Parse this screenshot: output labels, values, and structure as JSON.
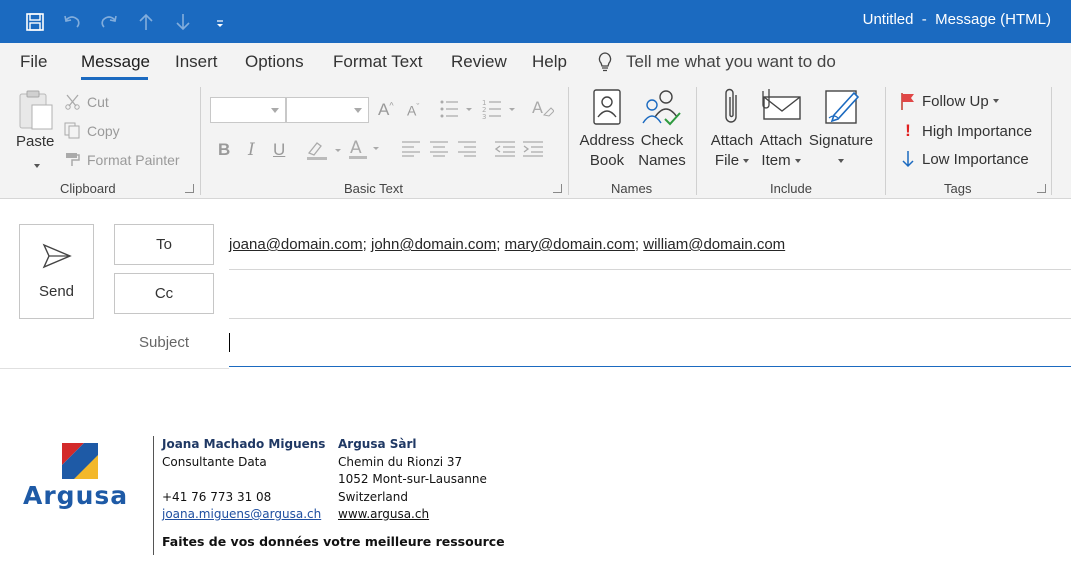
{
  "window": {
    "title": "Untitled  -  Message (HTML)"
  },
  "tabs": [
    {
      "label": "File"
    },
    {
      "label": "Message"
    },
    {
      "label": "Insert"
    },
    {
      "label": "Options"
    },
    {
      "label": "Format Text"
    },
    {
      "label": "Review"
    },
    {
      "label": "Help"
    }
  ],
  "tell_me": {
    "label": "Tell me what you want to do"
  },
  "ribbon": {
    "clipboard": {
      "paste": "Paste",
      "cut": "Cut",
      "copy": "Copy",
      "format_painter": "Format Painter",
      "group": "Clipboard"
    },
    "basic_text": {
      "bold": "B",
      "italic": "I",
      "underline": "U",
      "group": "Basic Text"
    },
    "names": {
      "address_book_1": "Address",
      "address_book_2": "Book",
      "check_names_1": "Check",
      "check_names_2": "Names",
      "group": "Names"
    },
    "include": {
      "attach_file_1": "Attach",
      "attach_file_2": "File",
      "attach_item_1": "Attach",
      "attach_item_2": "Item",
      "signature": "Signature",
      "group": "Include"
    },
    "tags": {
      "follow_up": "Follow Up",
      "high": "High Importance",
      "low": "Low Importance",
      "group": "Tags"
    }
  },
  "compose": {
    "send": "Send",
    "to": "To",
    "cc": "Cc",
    "subject": "Subject",
    "recipients": [
      "joana@domain.com",
      "john@domain.com",
      "mary@domain.com",
      "william@domain.com"
    ]
  },
  "signature": {
    "logo": "Argusa",
    "name": "Joana Machado Miguens",
    "role": "Consultante Data",
    "phone": "+41 76 773 31 08",
    "email": "joana.miguens@argusa.ch",
    "company": "Argusa Sàrl",
    "street": "Chemin du Rionzi 37",
    "city": "1052 Mont-sur-Lausanne",
    "country": "Switzerland",
    "website": "www.argusa.ch",
    "slogan": "Faites de vos données votre meilleure ressource"
  },
  "colors": {
    "accent": "#1b6ac0",
    "ribbon_bg": "#f3f3f3",
    "logo_blue": "#1e5aa6",
    "logo_red": "#d32a2a",
    "logo_yellow": "#f3b82b"
  }
}
